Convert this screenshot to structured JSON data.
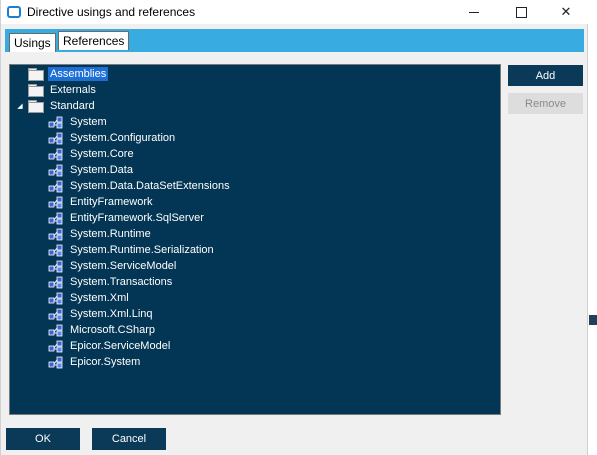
{
  "window": {
    "title": "Directive usings and references"
  },
  "tabs": [
    {
      "label": "Usings"
    },
    {
      "label": "References"
    }
  ],
  "tree": {
    "assemblies": "Assemblies",
    "externals": "Externals",
    "standard": "Standard",
    "standard_items": [
      "System",
      "System.Configuration",
      "System.Core",
      "System.Data",
      "System.Data.DataSetExtensions",
      "EntityFramework",
      "EntityFramework.SqlServer",
      "System.Runtime",
      "System.Runtime.Serialization",
      "System.ServiceModel",
      "System.Transactions",
      "System.Xml",
      "System.Xml.Linq",
      "Microsoft.CSharp",
      "Epicor.ServiceModel",
      "Epicor.System"
    ]
  },
  "buttons": {
    "add": "Add",
    "remove": "Remove",
    "ok": "OK",
    "cancel": "Cancel"
  },
  "colors": {
    "tree_background": "#033554",
    "selection": "#1d6fd6",
    "tab_strip": "#38abe0",
    "button_dark": "#0a3a57"
  }
}
